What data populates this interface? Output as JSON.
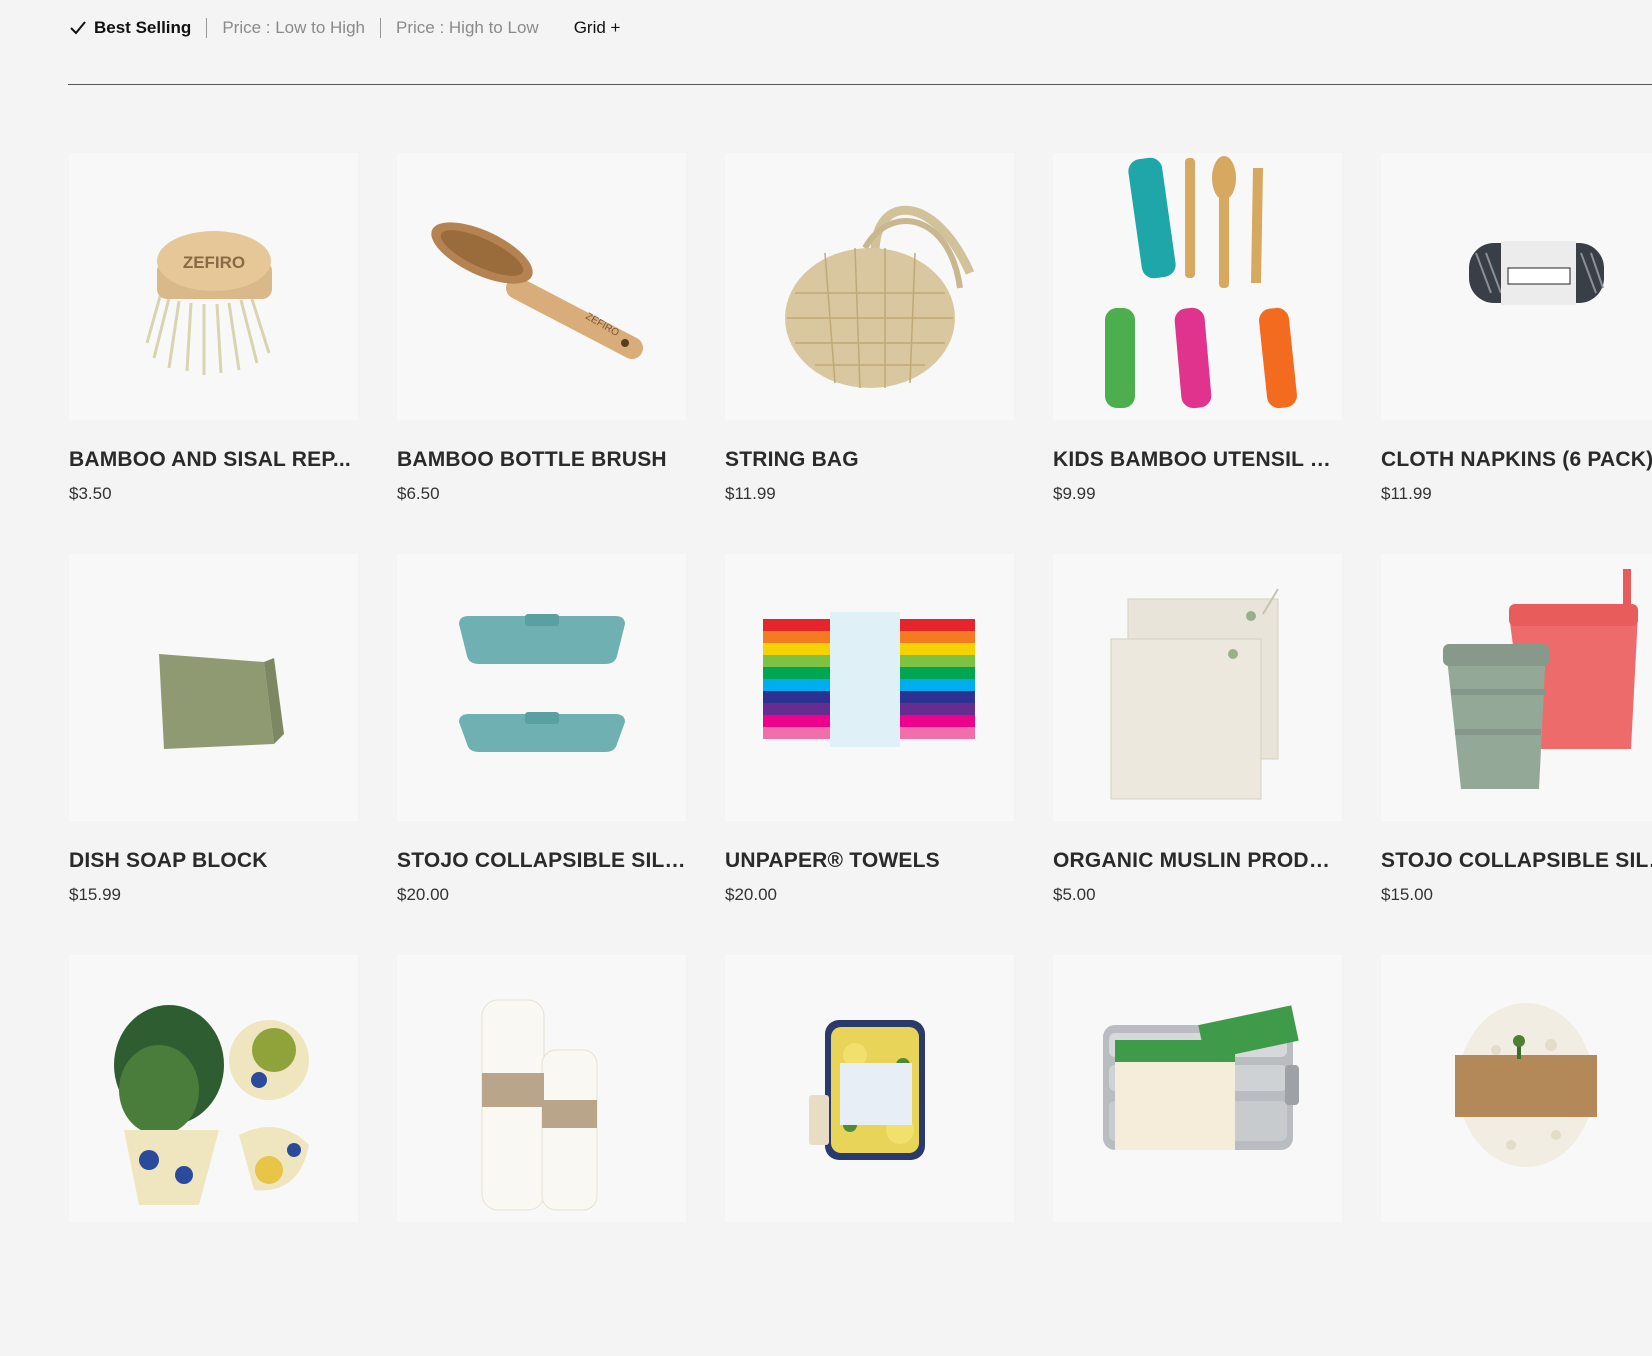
{
  "sort": {
    "options": [
      {
        "label": "Best Selling",
        "active": true
      },
      {
        "label": "Price : Low to High",
        "active": false
      },
      {
        "label": "Price : High to Low",
        "active": false
      }
    ],
    "grid_label": "Grid +"
  },
  "products": [
    {
      "name": "BAMBOO AND SISAL REP...",
      "price": "$3.50",
      "icon": "bamboo-sisal-brush-head-image",
      "image_text": "ZEFIRO"
    },
    {
      "name": "BAMBOO BOTTLE BRUSH",
      "price": "$6.50",
      "icon": "bottle-brush-image",
      "image_text": "ZEFIRO"
    },
    {
      "name": "STRING BAG",
      "price": "$11.99",
      "icon": "string-bag-image"
    },
    {
      "name": "KIDS BAMBOO UTENSIL SET",
      "price": "$9.99",
      "icon": "utensil-set-image"
    },
    {
      "name": "CLOTH NAPKINS (6 PACK)",
      "price": "$11.99",
      "icon": "cloth-napkins-image"
    },
    {
      "name": "DISH SOAP BLOCK",
      "price": "$15.99",
      "icon": "soap-block-image"
    },
    {
      "name": "STOJO COLLAPSIBLE SILIC...",
      "price": "$20.00",
      "icon": "collapsible-container-image"
    },
    {
      "name": "UNPAPER® TOWELS",
      "price": "$20.00",
      "icon": "unpaper-towels-image"
    },
    {
      "name": "ORGANIC MUSLIN PRODU...",
      "price": "$5.00",
      "icon": "muslin-produce-bags-image"
    },
    {
      "name": "STOJO COLLAPSIBLE SILIC...",
      "price": "$15.00",
      "icon": "collapsible-cups-image"
    },
    {
      "name": "",
      "price": "",
      "icon": "beeswax-wraps-image"
    },
    {
      "name": "",
      "price": "",
      "icon": "dish-cloths-image"
    },
    {
      "name": "",
      "price": "",
      "icon": "sponge-image"
    },
    {
      "name": "",
      "price": "",
      "icon": "lunchbox-image"
    },
    {
      "name": "",
      "price": "",
      "icon": "eco-dish-sponge-image"
    }
  ],
  "colors": {
    "background": "#f4f4f4",
    "tile": "#f8f8f8",
    "active_sort": "#111111",
    "inactive_sort": "#8a8a8a"
  }
}
